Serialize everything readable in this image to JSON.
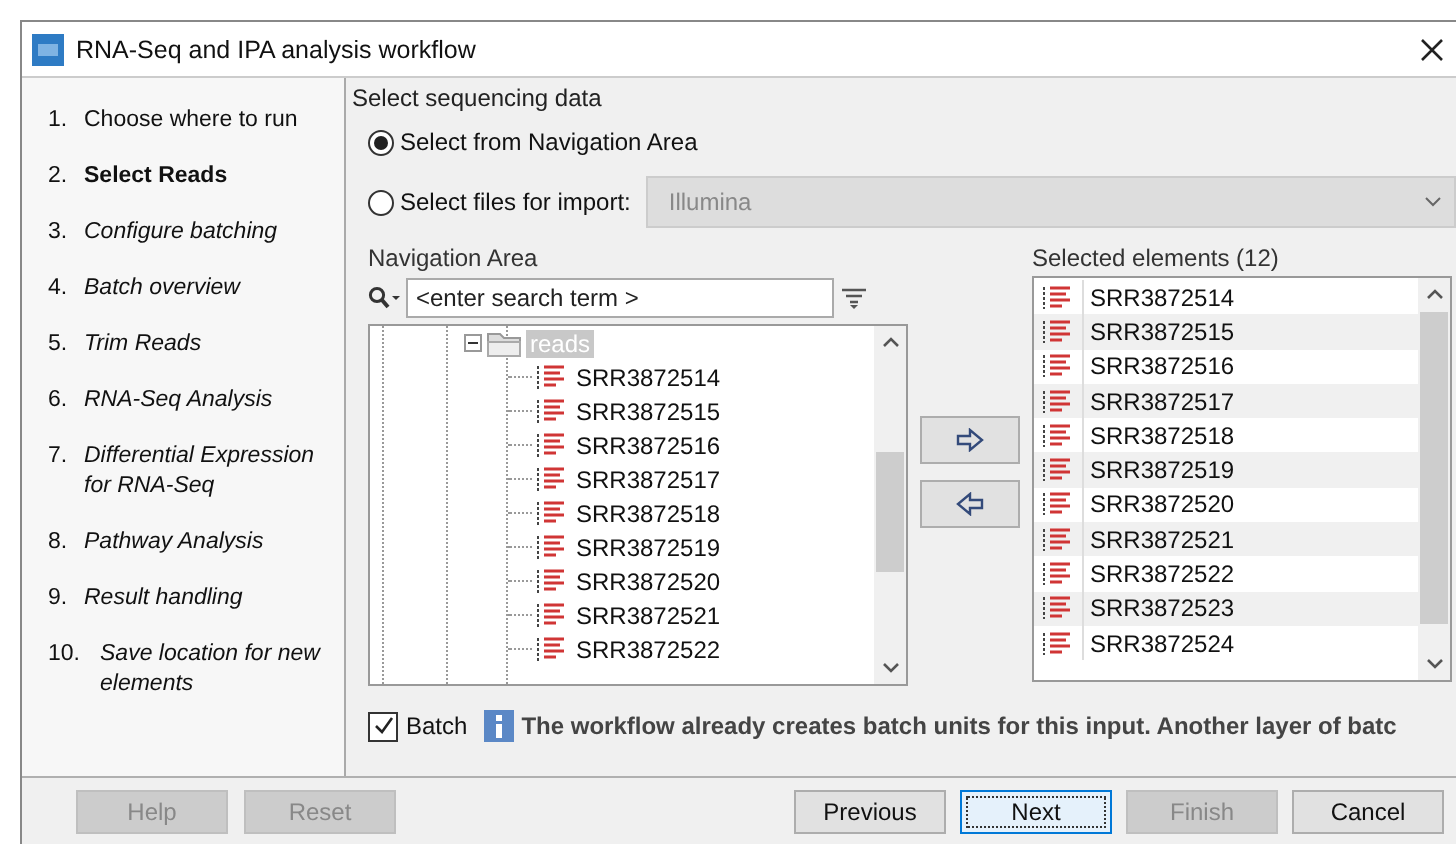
{
  "window": {
    "title": "RNA-Seq and IPA analysis workflow"
  },
  "steps": [
    {
      "number": "1.",
      "label": "Choose where to run",
      "kind": "done"
    },
    {
      "number": "2.",
      "label": "Select Reads",
      "kind": "current"
    },
    {
      "number": "3.",
      "label": "Configure batching",
      "kind": "pending"
    },
    {
      "number": "4.",
      "label": "Batch overview",
      "kind": "pending"
    },
    {
      "number": "5.",
      "label": "Trim Reads",
      "kind": "pending"
    },
    {
      "number": "6.",
      "label": "RNA-Seq Analysis",
      "kind": "pending"
    },
    {
      "number": "7.",
      "label": "Differential Expression for RNA-Seq",
      "kind": "pending"
    },
    {
      "number": "8.",
      "label": "Pathway Analysis",
      "kind": "pending"
    },
    {
      "number": "9.",
      "label": "Result handling",
      "kind": "pending"
    },
    {
      "number": "10.",
      "label": "Save location for new elements",
      "kind": "pending"
    }
  ],
  "section_title": "Select sequencing data",
  "source_options": [
    {
      "label": "Select from Navigation Area",
      "selected": true
    },
    {
      "label": "Select files for import:",
      "selected": false
    }
  ],
  "import_format": {
    "value": "Illumina",
    "disabled": true
  },
  "navigation": {
    "title": "Navigation Area",
    "search": {
      "placeholder": "<enter search term >"
    },
    "tree": [
      {
        "label": "reads",
        "expanded": true,
        "selected": true,
        "children": [
          {
            "label": "SRR3872514",
            "selected": false
          },
          {
            "label": "SRR3872515",
            "selected": false
          },
          {
            "label": "SRR3872516",
            "selected": false
          },
          {
            "label": "SRR3872517",
            "selected": false
          },
          {
            "label": "SRR3872518",
            "selected": false
          },
          {
            "label": "SRR3872519",
            "selected": false
          },
          {
            "label": "SRR3872520",
            "selected": false
          },
          {
            "label": "SRR3872521",
            "selected": false
          },
          {
            "label": "SRR3872522",
            "selected": false
          }
        ]
      }
    ]
  },
  "selected_elements": {
    "title": "Selected elements (12)",
    "items": [
      "SRR3872514",
      "SRR3872515",
      "SRR3872516",
      "SRR3872517",
      "SRR3872518",
      "SRR3872519",
      "SRR3872520",
      "SRR3872521",
      "SRR3872522",
      "SRR3872523",
      "SRR3872524"
    ]
  },
  "batch": {
    "label": "Batch",
    "checked": true,
    "message": "The workflow already creates batch units for this input. Another layer of batc"
  },
  "buttons": [
    {
      "label": "Help",
      "disabled": true,
      "focused": false
    },
    {
      "label": "Reset",
      "disabled": true,
      "focused": false
    },
    {
      "label": "Previous",
      "disabled": false,
      "focused": false
    },
    {
      "label": "Next",
      "disabled": false,
      "focused": true
    },
    {
      "label": "Finish",
      "disabled": true,
      "focused": false
    },
    {
      "label": "Cancel",
      "disabled": false,
      "focused": false
    }
  ]
}
